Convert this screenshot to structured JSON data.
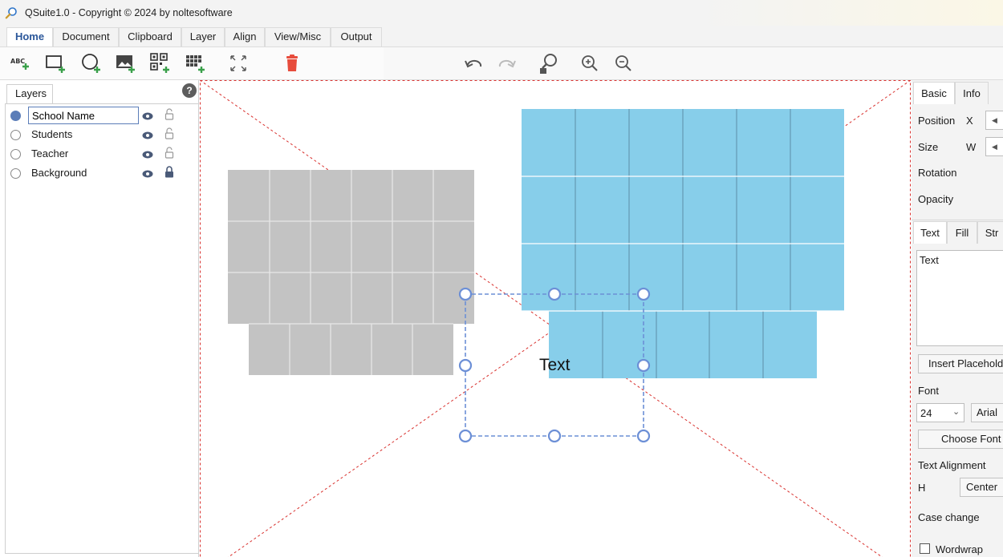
{
  "window": {
    "title": "QSuite1.0 - Copyright © 2024 by noltesoftware"
  },
  "ribbon": {
    "tabs": [
      {
        "label": "Home"
      },
      {
        "label": "Document"
      },
      {
        "label": "Clipboard"
      },
      {
        "label": "Layer"
      },
      {
        "label": "Align"
      },
      {
        "label": "View/Misc"
      },
      {
        "label": "Output"
      }
    ],
    "active_tab": "Home"
  },
  "toolbar": {
    "tools": [
      {
        "icon": "add-text-icon",
        "label": "ABC"
      },
      {
        "icon": "add-rectangle-icon"
      },
      {
        "icon": "add-ellipse-icon"
      },
      {
        "icon": "add-image-icon"
      },
      {
        "icon": "add-qrcode-icon"
      },
      {
        "icon": "add-barcode-icon"
      },
      {
        "icon": "fit-size-icon"
      },
      {
        "icon": "delete-icon"
      },
      {
        "icon": "undo-icon"
      },
      {
        "icon": "redo-icon"
      },
      {
        "icon": "zoom-fit-icon"
      },
      {
        "icon": "zoom-in-icon"
      },
      {
        "icon": "zoom-out-icon"
      }
    ],
    "delete_color": "#e74c3c",
    "add_color": "#3aa04a"
  },
  "layers_panel": {
    "tab_label": "Layers",
    "help_label": "?",
    "layers": [
      {
        "name": "School Name",
        "selected": true,
        "visible": true,
        "locked": false,
        "editing": true
      },
      {
        "name": "Students",
        "selected": false,
        "visible": true,
        "locked": false
      },
      {
        "name": "Teacher",
        "selected": false,
        "visible": true,
        "locked": false
      },
      {
        "name": "Background",
        "selected": false,
        "visible": true,
        "locked": true
      }
    ]
  },
  "canvas": {
    "selected_text": "Text",
    "gray_color": "#c3c3c3",
    "blue_color": "#87ceea",
    "guide_color": "#d9322f",
    "selection_color": "#6c8fd6"
  },
  "properties_panel": {
    "top_tabs": [
      {
        "label": "Basic"
      },
      {
        "label": "Info"
      }
    ],
    "position_label": "Position",
    "position_axis": "X",
    "size_label": "Size",
    "size_axis": "W",
    "rotation_label": "Rotation",
    "opacity_label": "Opacity",
    "sub_tabs": [
      {
        "label": "Text"
      },
      {
        "label": "Fill"
      },
      {
        "label": "Str"
      }
    ],
    "text_value": "Text",
    "insert_placeholder_label": "Insert Placehold",
    "font_label": "Font",
    "font_size": "24",
    "font_family": "Arial",
    "choose_font_label": "Choose Font",
    "text_alignment_label": "Text Alignment",
    "h_label": "H",
    "h_align_value": "Center",
    "case_change_label": "Case change",
    "wordwrap_label": "Wordwrap"
  }
}
